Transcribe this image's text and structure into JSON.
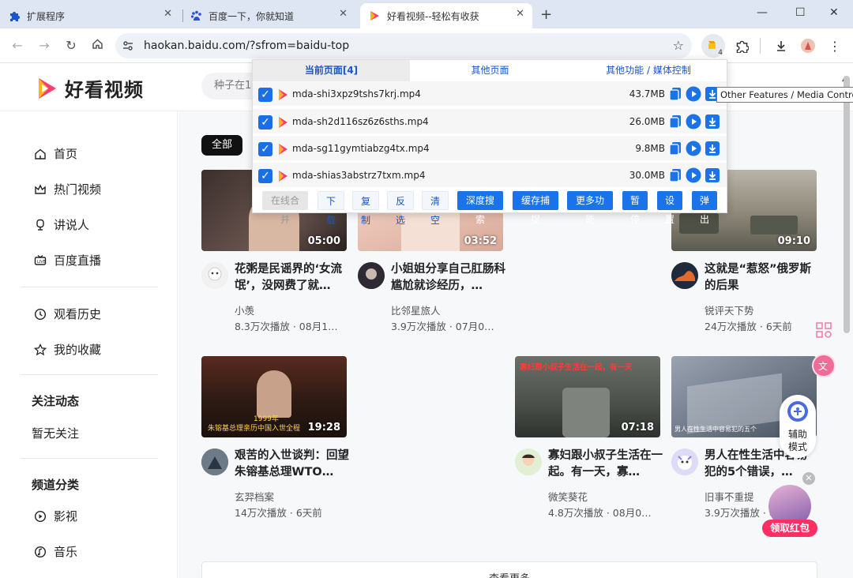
{
  "browser": {
    "tabs": [
      {
        "label": "扩展程序",
        "active": false
      },
      {
        "label": "百度一下，你就知道",
        "active": false
      },
      {
        "label": "好看视频--轻松有收获",
        "active": true
      }
    ],
    "url": "haokan.baidu.com/?sfrom=baidu-top",
    "extension_badge": "4"
  },
  "site": {
    "logo_text": "好看视频",
    "search_placeholder": "种子在1",
    "sidebar": {
      "items_top": [
        "首页",
        "热门视频",
        "讲说人",
        "百度直播"
      ],
      "items_mid": [
        "观看历史",
        "我的收藏"
      ],
      "follow_head": "关注动态",
      "follow_empty": "暂无关注",
      "channel_head": "频道分类",
      "channels": [
        "影视",
        "音乐"
      ]
    },
    "filter_all": "全部",
    "more": "查看更多",
    "assist": "辅助\n模式",
    "redpack": "领取红包",
    "videos": [
      {
        "duration": "05:00",
        "title": "花粥是民谣界的‘女流氓’，没网费了就…",
        "author": "小羡",
        "meta": "8.3万次播放 · 08月1…"
      },
      {
        "duration": "03:52",
        "title": "小姐姐分享自己肛肠科尴尬就诊经历，…",
        "author": "比邻星旅人",
        "meta": "3.9万次播放 · 07月0…"
      },
      {
        "duration": "09:10",
        "title": "这就是“惹怒”俄罗斯的后果",
        "author": "锐评天下势",
        "meta": "24万次播放 · 6天前"
      },
      {
        "duration": "19:28",
        "thumb_caption": "朱镕基总理亲历中国入世全程",
        "thumb_year": "1999年",
        "title": "艰苦的入世谈判：回望朱镕基总理WTO…",
        "author": "玄羿档案",
        "meta": "14万次播放 · 6天前"
      },
      {
        "duration": "07:18",
        "thumb_caption": "寡妇跟小叔子生活在一起，有一天",
        "title": "寡妇跟小叔子生活在一起。有一天，寡…",
        "author": "微笑葵花",
        "meta": "4.8万次播放 · 08月0…"
      },
      {
        "duration": "",
        "thumb_caption": "男人在性生活中容易犯的五个",
        "title": "男人在性生活中容易犯的5个错误，…",
        "author": "旧事不重提",
        "meta": "3.9万次播放 · 6天前"
      }
    ]
  },
  "popup": {
    "tabs": [
      "当前页面[4]",
      "其他页面",
      "其他功能 / 媒体控制"
    ],
    "files": [
      {
        "name": "mda-shi3xpz9tshs7krj.mp4",
        "size": "43.7MB"
      },
      {
        "name": "mda-sh2d116sz6z6sths.mp4",
        "size": "26.0MB"
      },
      {
        "name": "mda-sg11gymtiabzg4tx.mp4",
        "size": "9.8MB"
      },
      {
        "name": "mda-shias3abstrz7txm.mp4",
        "size": "30.0MB"
      }
    ],
    "buttons": [
      "在线合并",
      "下载",
      "复制",
      "反选",
      "清空",
      "深度搜索",
      "缓存捕捉",
      "更多功能",
      "暂停",
      "设置",
      "弹出"
    ],
    "tooltip": "Other Features / Media Control"
  },
  "colors": {
    "accent": "#1a73e8",
    "brand_pink": "#ff3a6e",
    "brand_orange": "#ffb21e"
  }
}
